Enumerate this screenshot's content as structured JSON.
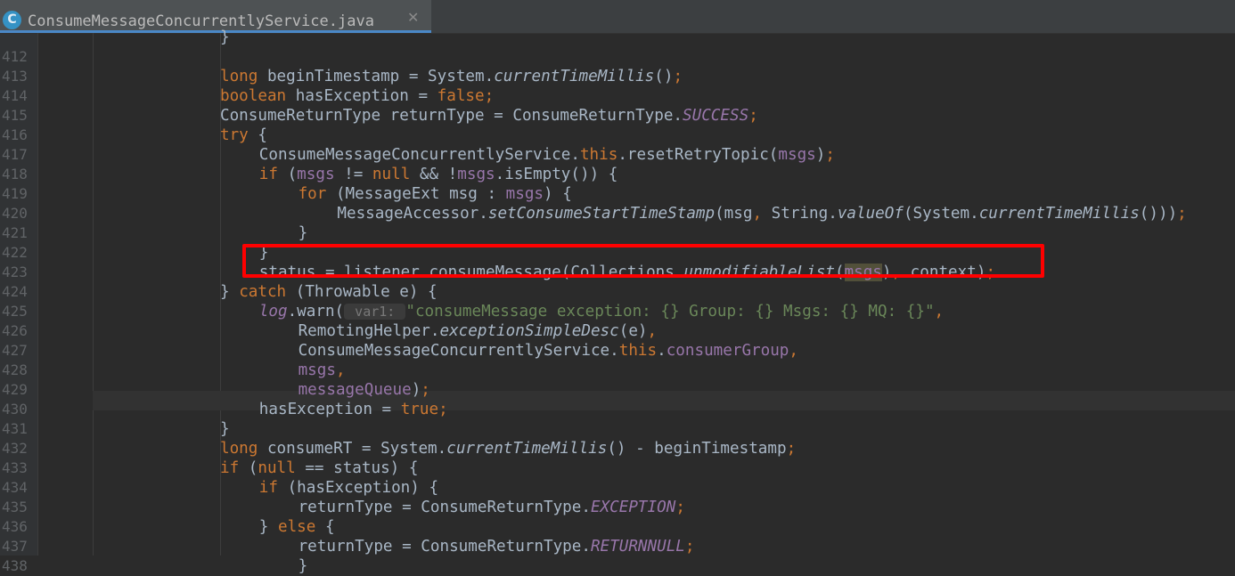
{
  "tab": {
    "icon_letter": "C",
    "title": "ConsumeMessageConcurrentlyService.java",
    "close": "✕"
  },
  "colors": {
    "keyword": "#cc7832",
    "field": "#9876aa",
    "string": "#6a8759",
    "text": "#a9b7c6",
    "highlight_box": "#ff0000",
    "background": "#2b2b2b"
  },
  "lines": [
    {
      "num": "",
      "indent": 5,
      "segs": [
        [
          "}",
          ""
        ]
      ]
    },
    {
      "num": "412",
      "indent": 0,
      "segs": []
    },
    {
      "num": "413",
      "indent": 5,
      "segs": [
        [
          "long",
          "kw"
        ],
        [
          " beginTimestamp = System.",
          ""
        ],
        [
          "currentTimeMillis",
          "sm"
        ],
        [
          "()",
          ""
        ],
        [
          ";",
          "kw"
        ]
      ]
    },
    {
      "num": "414",
      "indent": 5,
      "segs": [
        [
          "boolean",
          "kw"
        ],
        [
          " hasException = ",
          ""
        ],
        [
          "false",
          "kw"
        ],
        [
          ";",
          "kw"
        ]
      ]
    },
    {
      "num": "415",
      "indent": 5,
      "segs": [
        [
          "ConsumeReturnType returnType = ConsumeReturnType.",
          ""
        ],
        [
          "SUCCESS",
          "stf"
        ],
        [
          ";",
          "kw"
        ]
      ]
    },
    {
      "num": "416",
      "indent": 5,
      "segs": [
        [
          "try",
          "kw"
        ],
        [
          " {",
          ""
        ]
      ]
    },
    {
      "num": "417",
      "indent": 6,
      "segs": [
        [
          "ConsumeMessageConcurrentlyService.",
          ""
        ],
        [
          "this",
          "kw"
        ],
        [
          ".resetRetryTopic(",
          ""
        ],
        [
          "msgs",
          "fld"
        ],
        [
          ")",
          ""
        ],
        [
          ";",
          "kw"
        ]
      ]
    },
    {
      "num": "418",
      "indent": 6,
      "segs": [
        [
          "if",
          "kw"
        ],
        [
          " (",
          ""
        ],
        [
          "msgs",
          "fld"
        ],
        [
          " != ",
          ""
        ],
        [
          "null",
          "kw"
        ],
        [
          " && !",
          ""
        ],
        [
          "msgs",
          "fld"
        ],
        [
          ".isEmpty()) {",
          ""
        ]
      ]
    },
    {
      "num": "419",
      "indent": 7,
      "segs": [
        [
          "for",
          "kw"
        ],
        [
          " (MessageExt msg : ",
          ""
        ],
        [
          "msgs",
          "fld"
        ],
        [
          ") {",
          ""
        ]
      ]
    },
    {
      "num": "420",
      "indent": 8,
      "segs": [
        [
          "MessageAccessor.",
          ""
        ],
        [
          "setConsumeStartTimeStamp",
          "sm"
        ],
        [
          "(msg",
          ""
        ],
        [
          ",",
          "kw"
        ],
        [
          " String.",
          ""
        ],
        [
          "valueOf",
          "sm"
        ],
        [
          "(System.",
          ""
        ],
        [
          "currentTimeMillis",
          "sm"
        ],
        [
          "()))",
          ""
        ],
        [
          ";",
          "kw"
        ]
      ]
    },
    {
      "num": "421",
      "indent": 7,
      "segs": [
        [
          "}",
          ""
        ]
      ]
    },
    {
      "num": "422",
      "indent": 6,
      "segs": [
        [
          "}",
          ""
        ]
      ]
    },
    {
      "num": "423",
      "indent": 6,
      "segs": [
        [
          "status = listener.consumeMessage(Collections.",
          ""
        ],
        [
          "unmodifiableList",
          "sm"
        ],
        [
          "(",
          ""
        ],
        [
          "msgs",
          "fld hlref"
        ],
        [
          ")",
          ""
        ],
        [
          ",",
          "kw"
        ],
        [
          " context)",
          ""
        ],
        [
          ";",
          "kw"
        ]
      ]
    },
    {
      "num": "424",
      "indent": 5,
      "segs": [
        [
          "} ",
          ""
        ],
        [
          "catch",
          "kw"
        ],
        [
          " (Throwable e) {",
          ""
        ]
      ]
    },
    {
      "num": "425",
      "indent": 6,
      "segs": [
        [
          "log",
          "stf"
        ],
        [
          ".warn(",
          ""
        ],
        [
          " var1: ",
          "hint"
        ],
        [
          "\"consumeMessage exception: {} Group: {} Msgs: {} MQ: {}\"",
          "str"
        ],
        [
          ",",
          "kw"
        ]
      ]
    },
    {
      "num": "426",
      "indent": 7,
      "segs": [
        [
          "RemotingHelper.",
          ""
        ],
        [
          "exceptionSimpleDesc",
          "sm"
        ],
        [
          "(e)",
          ""
        ],
        [
          ",",
          "kw"
        ]
      ]
    },
    {
      "num": "427",
      "indent": 7,
      "segs": [
        [
          "ConsumeMessageConcurrentlyService.",
          ""
        ],
        [
          "this",
          "kw"
        ],
        [
          ".",
          ""
        ],
        [
          "consumerGroup",
          "fld"
        ],
        [
          ",",
          "kw"
        ]
      ]
    },
    {
      "num": "428",
      "indent": 7,
      "segs": [
        [
          "msgs",
          "fld"
        ],
        [
          ",",
          "kw"
        ]
      ]
    },
    {
      "num": "429",
      "indent": 7,
      "segs": [
        [
          "messageQueue",
          "fld"
        ],
        [
          ")",
          ""
        ],
        [
          ";",
          "kw"
        ]
      ]
    },
    {
      "num": "430",
      "indent": 6,
      "segs": [
        [
          "hasException = ",
          ""
        ],
        [
          "true",
          "kw"
        ],
        [
          ";",
          "kw"
        ]
      ]
    },
    {
      "num": "431",
      "indent": 5,
      "segs": [
        [
          "}",
          ""
        ]
      ]
    },
    {
      "num": "432",
      "indent": 5,
      "segs": [
        [
          "long",
          "kw"
        ],
        [
          " consumeRT = System.",
          ""
        ],
        [
          "currentTimeMillis",
          "sm"
        ],
        [
          "() - beginTimestamp",
          ""
        ],
        [
          ";",
          "kw"
        ]
      ]
    },
    {
      "num": "433",
      "indent": 5,
      "segs": [
        [
          "if",
          "kw"
        ],
        [
          " (",
          ""
        ],
        [
          "null",
          "kw"
        ],
        [
          " == status) {",
          ""
        ]
      ]
    },
    {
      "num": "434",
      "indent": 6,
      "segs": [
        [
          "if",
          "kw"
        ],
        [
          " (hasException) {",
          ""
        ]
      ]
    },
    {
      "num": "435",
      "indent": 7,
      "segs": [
        [
          "returnType = ConsumeReturnType.",
          ""
        ],
        [
          "EXCEPTION",
          "stf"
        ],
        [
          ";",
          "kw"
        ]
      ]
    },
    {
      "num": "436",
      "indent": 6,
      "segs": [
        [
          "} ",
          ""
        ],
        [
          "else",
          "kw"
        ],
        [
          " {",
          ""
        ]
      ]
    },
    {
      "num": "437",
      "indent": 7,
      "segs": [
        [
          "returnType = ConsumeReturnType.",
          ""
        ],
        [
          "RETURNNULL",
          "stf"
        ],
        [
          ";",
          "kw"
        ]
      ]
    },
    {
      "num": "438",
      "indent": 7,
      "segs": [
        [
          "}",
          ""
        ]
      ]
    }
  ]
}
